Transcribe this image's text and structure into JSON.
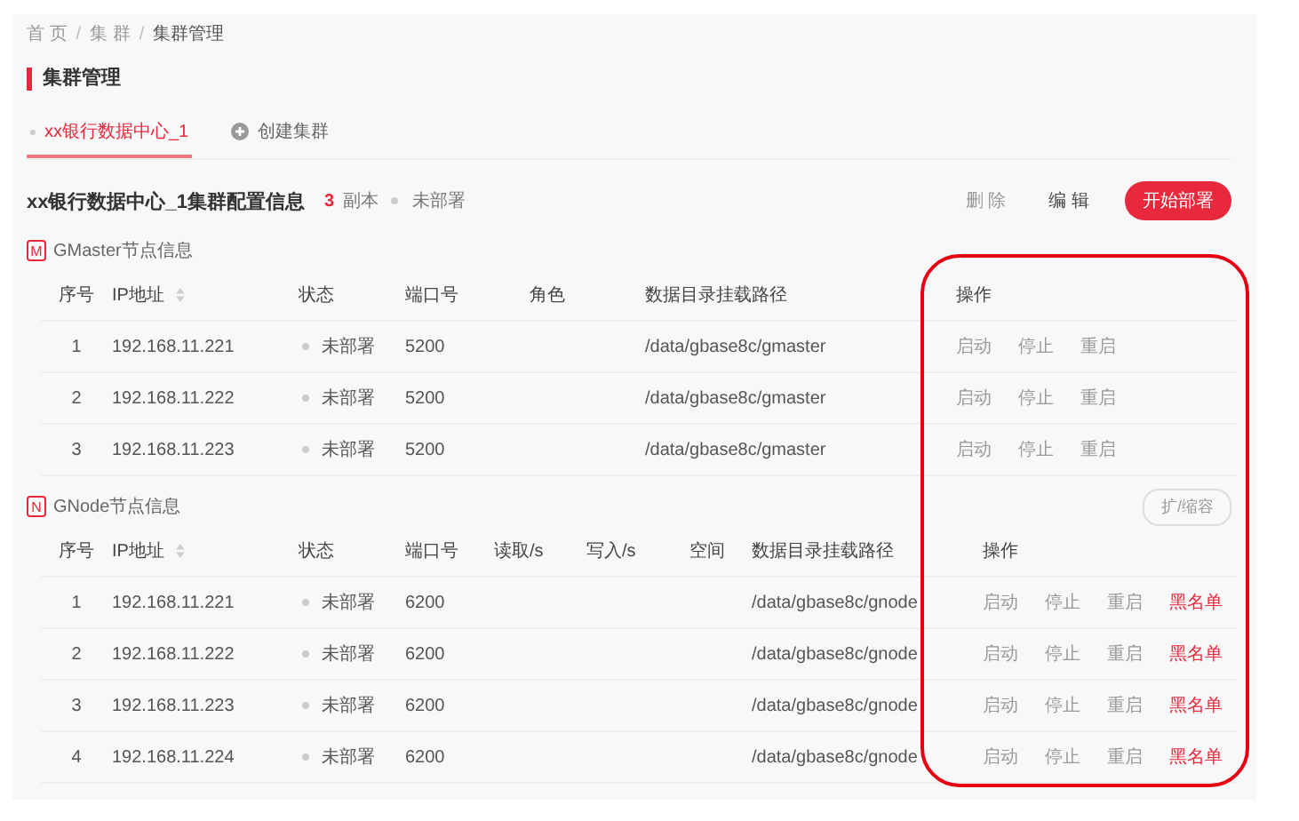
{
  "breadcrumb_separator": "/",
  "breadcrumb": [
    {
      "label": "首 页",
      "current": false
    },
    {
      "label": "集 群",
      "current": false
    },
    {
      "label": "集群管理",
      "current": true
    }
  ],
  "page_title": "集群管理",
  "tabs": [
    {
      "label": "xx银行数据中心_1",
      "selected": true,
      "kind": "cluster"
    },
    {
      "label": "创建集群",
      "selected": false,
      "kind": "add"
    }
  ],
  "config": {
    "title": "xx银行数据中心_1集群配置信息",
    "replica_count": "3",
    "replica_label": "副本",
    "status": "未部署"
  },
  "actions": [
    {
      "label": "删 除",
      "kind": "text",
      "disabled": true
    },
    {
      "label": "编 辑",
      "kind": "text",
      "disabled": false
    },
    {
      "label": "开始部署",
      "kind": "primary",
      "disabled": false
    }
  ],
  "sections": [
    {
      "badge": "M",
      "title": "GMaster节点信息",
      "columns": [
        {
          "label": "序号",
          "sortable": false
        },
        {
          "label": "IP地址",
          "sortable": true
        },
        {
          "label": "状态",
          "sortable": false
        },
        {
          "label": "端口号",
          "sortable": false
        },
        {
          "label": "角色",
          "sortable": false
        },
        {
          "label": "数据目录挂载路径",
          "sortable": false
        },
        {
          "label": "操作",
          "sortable": false
        }
      ],
      "rows": [
        {
          "index": "1",
          "ip": "192.168.11.221",
          "status": "未部署",
          "port": "5200",
          "path": "/data/gbase8c/gmaster",
          "actions": [
            {
              "label": "启动",
              "disabled": true,
              "kind": "normal"
            },
            {
              "label": "停止",
              "disabled": true,
              "kind": "normal"
            },
            {
              "label": "重启",
              "disabled": true,
              "kind": "normal"
            }
          ]
        },
        {
          "index": "2",
          "ip": "192.168.11.222",
          "status": "未部署",
          "port": "5200",
          "path": "/data/gbase8c/gmaster",
          "actions": [
            {
              "label": "启动",
              "disabled": true,
              "kind": "normal"
            },
            {
              "label": "停止",
              "disabled": true,
              "kind": "normal"
            },
            {
              "label": "重启",
              "disabled": true,
              "kind": "normal"
            }
          ]
        },
        {
          "index": "3",
          "ip": "192.168.11.223",
          "status": "未部署",
          "port": "5200",
          "path": "/data/gbase8c/gmaster",
          "actions": [
            {
              "label": "启动",
              "disabled": true,
              "kind": "normal"
            },
            {
              "label": "停止",
              "disabled": true,
              "kind": "normal"
            },
            {
              "label": "重启",
              "disabled": true,
              "kind": "normal"
            }
          ]
        }
      ]
    },
    {
      "badge": "N",
      "title": "GNode节点信息",
      "toolbar_button": {
        "label": "扩/缩容",
        "disabled": true
      },
      "columns": [
        {
          "label": "序号",
          "sortable": false
        },
        {
          "label": "IP地址",
          "sortable": true
        },
        {
          "label": "状态",
          "sortable": false
        },
        {
          "label": "端口号",
          "sortable": false
        },
        {
          "label": "读取/s",
          "sortable": false
        },
        {
          "label": "写入/s",
          "sortable": false
        },
        {
          "label": "空间",
          "sortable": false
        },
        {
          "label": "数据目录挂载路径",
          "sortable": false
        },
        {
          "label": "操作",
          "sortable": false
        }
      ],
      "rows": [
        {
          "index": "1",
          "ip": "192.168.11.221",
          "status": "未部署",
          "port": "6200",
          "path": "/data/gbase8c/gnode",
          "actions": [
            {
              "label": "启动",
              "disabled": true,
              "kind": "normal"
            },
            {
              "label": "停止",
              "disabled": true,
              "kind": "normal"
            },
            {
              "label": "重启",
              "disabled": true,
              "kind": "normal"
            },
            {
              "label": "黑名单",
              "disabled": false,
              "kind": "danger"
            }
          ]
        },
        {
          "index": "2",
          "ip": "192.168.11.222",
          "status": "未部署",
          "port": "6200",
          "path": "/data/gbase8c/gnode",
          "actions": [
            {
              "label": "启动",
              "disabled": true,
              "kind": "normal"
            },
            {
              "label": "停止",
              "disabled": true,
              "kind": "normal"
            },
            {
              "label": "重启",
              "disabled": true,
              "kind": "normal"
            },
            {
              "label": "黑名单",
              "disabled": false,
              "kind": "danger"
            }
          ]
        },
        {
          "index": "3",
          "ip": "192.168.11.223",
          "status": "未部署",
          "port": "6200",
          "path": "/data/gbase8c/gnode",
          "actions": [
            {
              "label": "启动",
              "disabled": true,
              "kind": "normal"
            },
            {
              "label": "停止",
              "disabled": true,
              "kind": "normal"
            },
            {
              "label": "重启",
              "disabled": true,
              "kind": "normal"
            },
            {
              "label": "黑名单",
              "disabled": false,
              "kind": "danger"
            }
          ]
        },
        {
          "index": "4",
          "ip": "192.168.11.224",
          "status": "未部署",
          "port": "6200",
          "path": "/data/gbase8c/gnode",
          "actions": [
            {
              "label": "启动",
              "disabled": true,
              "kind": "normal"
            },
            {
              "label": "停止",
              "disabled": true,
              "kind": "normal"
            },
            {
              "label": "重启",
              "disabled": true,
              "kind": "normal"
            },
            {
              "label": "黑名单",
              "disabled": false,
              "kind": "danger"
            }
          ]
        }
      ]
    }
  ]
}
